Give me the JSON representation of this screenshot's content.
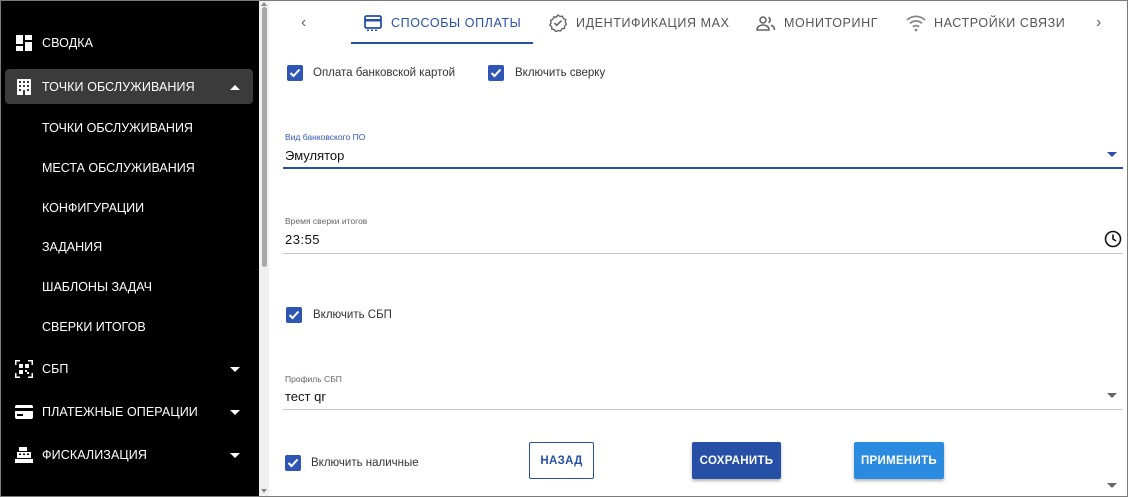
{
  "sidebar": {
    "items": [
      {
        "label": "СВОДКА",
        "icon": "dashboard-icon"
      },
      {
        "label": "ТОЧКИ ОБСЛУЖИВАНИЯ",
        "icon": "building-icon",
        "expanded": true
      },
      {
        "label": "СБП",
        "icon": "qr-code-icon"
      },
      {
        "label": "ПЛАТЕЖНЫЕ ОПЕРАЦИИ",
        "icon": "credit-card-icon"
      },
      {
        "label": "ФИСКАЛИЗАЦИЯ",
        "icon": "cash-register-icon"
      }
    ],
    "subitems": [
      "ТОЧКИ ОБСЛУЖИВАНИЯ",
      "МЕСТА ОБСЛУЖИВАНИЯ",
      "КОНФИГУРАЦИИ",
      "ЗАДАНИЯ",
      "ШАБЛОНЫ ЗАДАЧ",
      "СВЕРКИ ИТОГОВ"
    ]
  },
  "tabs": [
    {
      "label": "СПОСОБЫ ОПЛАТЫ",
      "icon": "payment-card-icon",
      "active": true
    },
    {
      "label": "ИДЕНТИФИКАЦИЯ MAX",
      "icon": "verified-badge-icon"
    },
    {
      "label": "МОНИТОРИНГ",
      "icon": "people-icon"
    },
    {
      "label": "НАСТРОЙКИ СВЯЗИ",
      "icon": "wifi-icon"
    }
  ],
  "form": {
    "card_payment_label": "Оплата банковской картой",
    "reconcile_label": "Включить сверку",
    "bank_sw_label": "Вид банковского ПО",
    "bank_sw_value": "Эмулятор",
    "reconcile_time_label": "Время сверки итогов",
    "reconcile_time_value": "23:55",
    "sbp_label": "Включить СБП",
    "sbp_profile_label": "Профиль СБП",
    "sbp_profile_value": "тест qr",
    "cash_label": "Включить наличные"
  },
  "buttons": {
    "back": "НАЗАД",
    "save": "СОХРАНИТЬ",
    "apply": "ПРИМЕНИТЬ"
  },
  "colors": {
    "accent": "#2650a6",
    "apply": "#2b8be0",
    "sidebar_bg": "#000000",
    "active_nav_bg": "#3b3b3b"
  }
}
